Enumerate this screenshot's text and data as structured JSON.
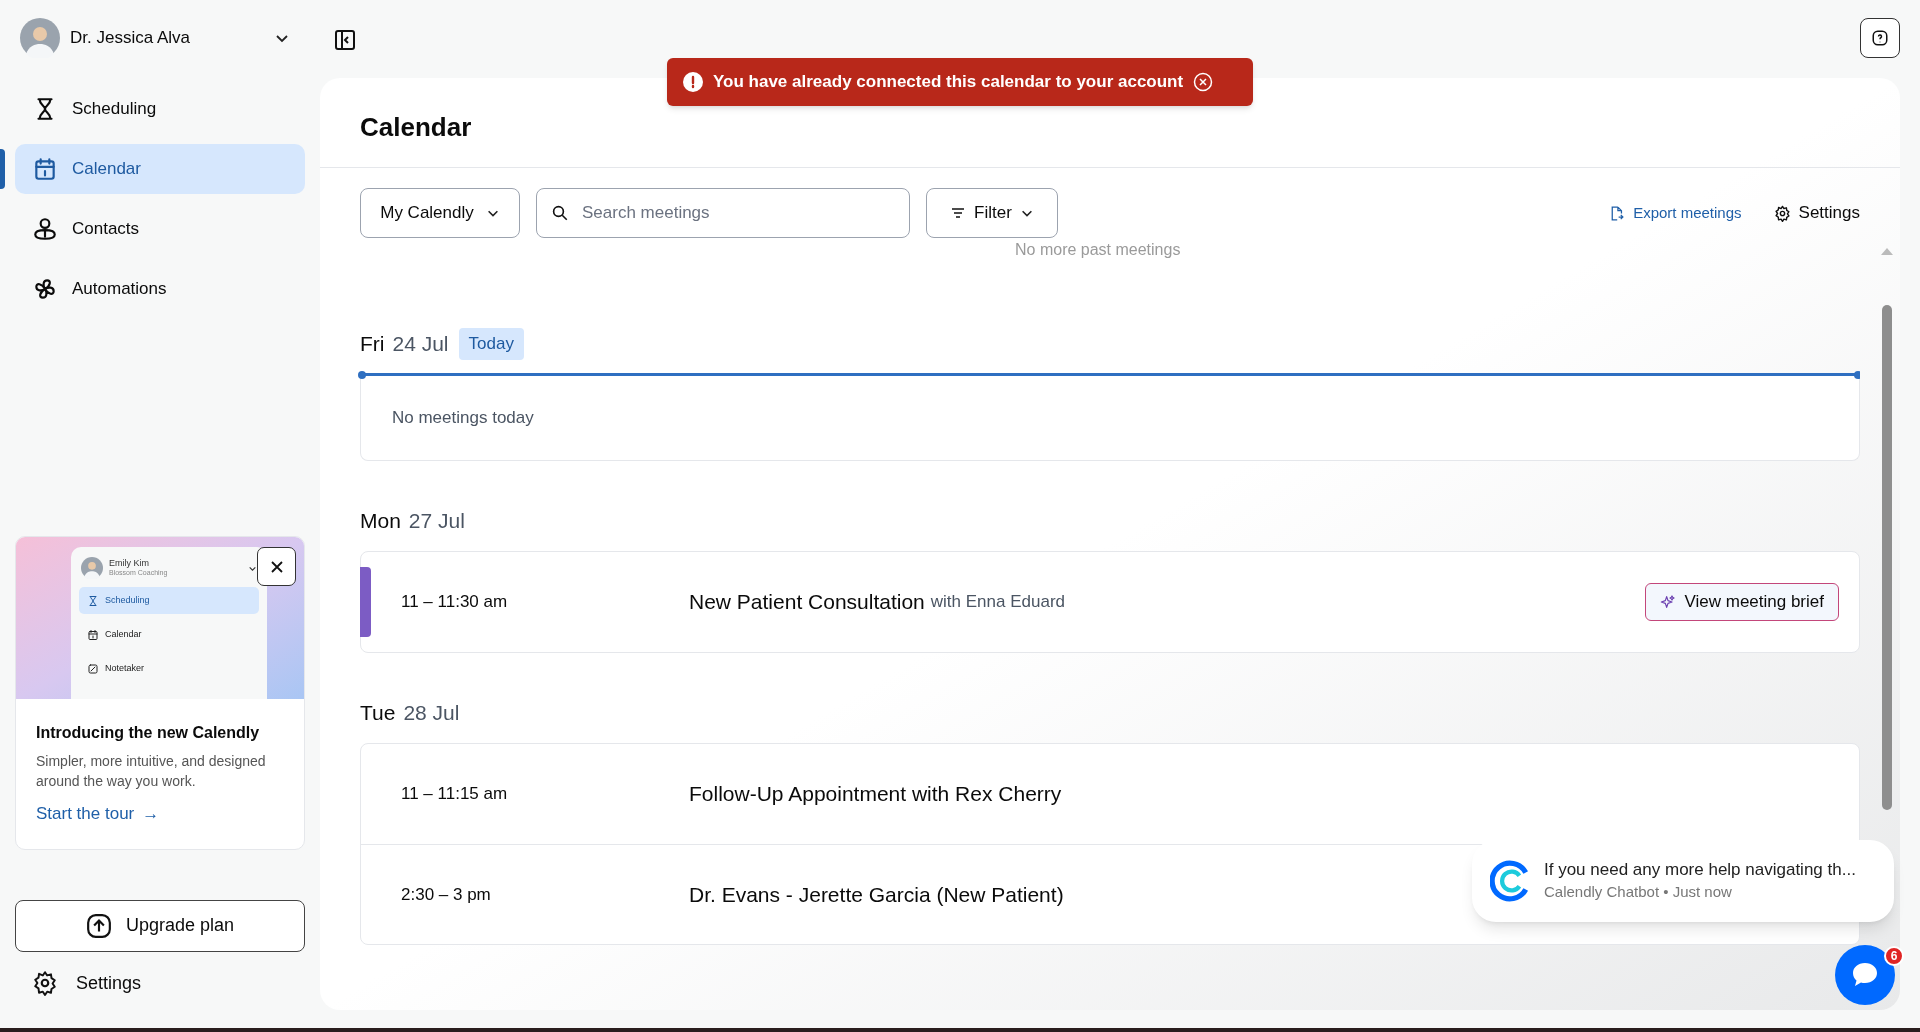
{
  "user": {
    "name": "Dr. Jessica Alva"
  },
  "nav": [
    {
      "label": "Scheduling",
      "selected": false
    },
    {
      "label": "Calendar",
      "selected": true
    },
    {
      "label": "Contacts",
      "selected": false
    },
    {
      "label": "Automations",
      "selected": false
    }
  ],
  "promo": {
    "preview": {
      "name": "Emily Kim",
      "subtitle": "Blossom Coaching",
      "items": [
        {
          "label": "Scheduling",
          "selected": true
        },
        {
          "label": "Calendar",
          "selected": false
        },
        {
          "label": "Notetaker",
          "selected": false
        }
      ]
    },
    "title": "Introducing the new Calendly",
    "text": "Simpler, more intuitive, and designed around the way you work.",
    "link": "Start the tour",
    "arrow": "→"
  },
  "upgrade": "Upgrade plan",
  "sidebar_settings": "Settings",
  "toast": {
    "message": "You have already connected this calendar to your account"
  },
  "page_title": "Calendar",
  "toolbar": {
    "scope": "My Calendly",
    "search": {
      "placeholder": "Search meetings"
    },
    "filter": "Filter",
    "export": "Export meetings",
    "settings": "Settings"
  },
  "past_note": "No more past meetings",
  "days": [
    {
      "weekday": "Fri",
      "date": "24 Jul",
      "today": true,
      "today_label": "Today",
      "empty": "No meetings today"
    },
    {
      "weekday": "Mon",
      "date": "27 Jul",
      "meetings": [
        {
          "time": "11 – 11:30 am",
          "title": "New Patient Consultation",
          "with": "with Enna Eduard",
          "color": "#7c5cc4",
          "action": "View meeting brief"
        }
      ]
    },
    {
      "weekday": "Tue",
      "date": "28 Jul",
      "meetings": [
        {
          "time": "11 – 11:15 am",
          "title": "Follow-Up Appointment with Rex Cherry"
        },
        {
          "time": "2:30 – 3 pm",
          "title": "Dr. Evans - Jerette Garcia (New Patient)"
        }
      ]
    }
  ],
  "chat": {
    "message": "If you need any more help navigating th...",
    "meta": "Calendly Chatbot • Just now",
    "badge": "6"
  }
}
